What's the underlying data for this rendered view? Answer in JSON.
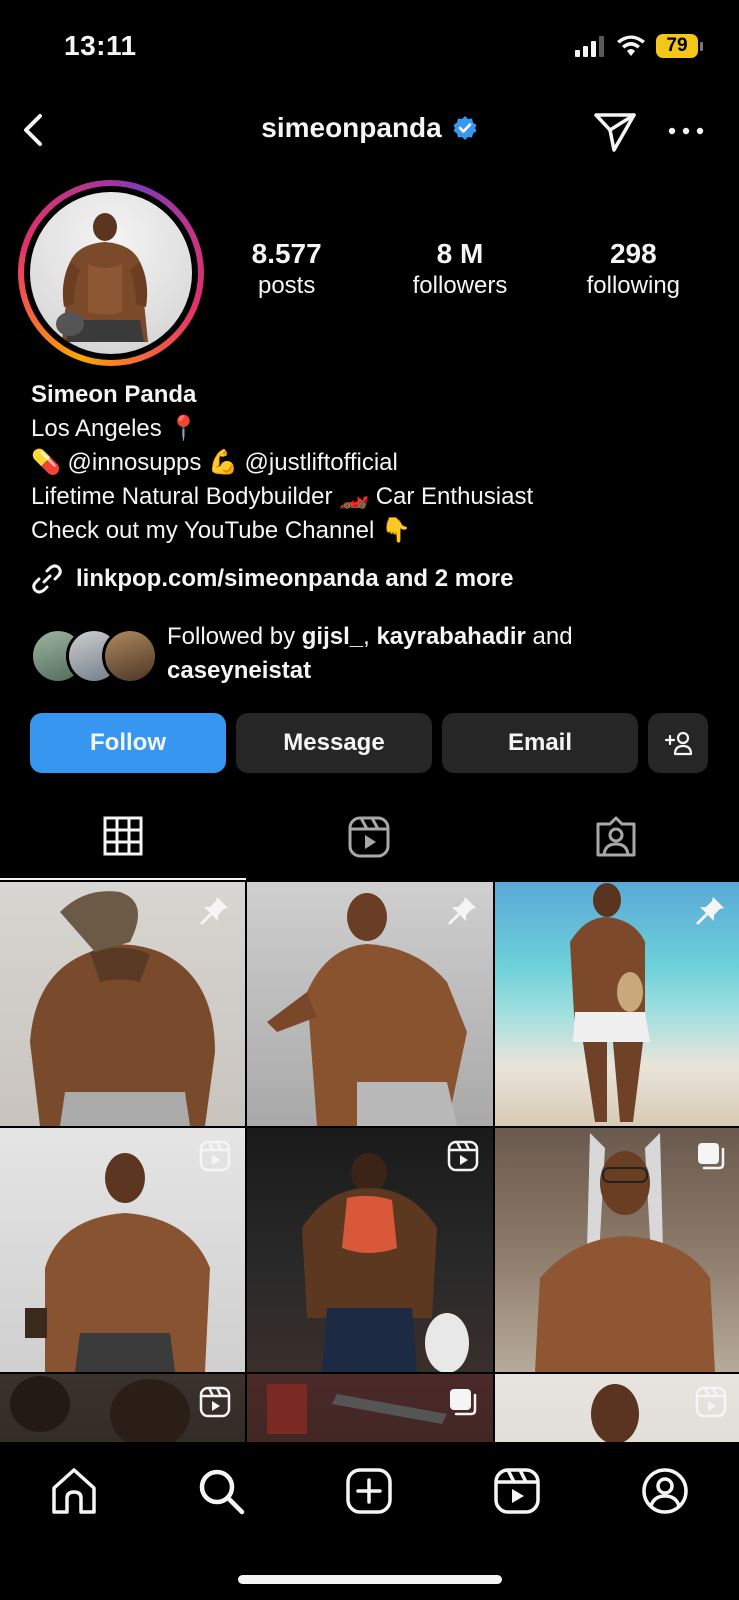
{
  "status": {
    "time": "13:11",
    "battery": "79"
  },
  "header": {
    "username": "simeonpanda",
    "verified": true
  },
  "stats": [
    {
      "value": "8.577",
      "label": "posts"
    },
    {
      "value": "8 M",
      "label": "followers"
    },
    {
      "value": "298",
      "label": "following"
    }
  ],
  "bio": {
    "name": "Simeon Panda",
    "lines": [
      "Los Angeles 📍",
      "💊 @innosupps 💪 @justliftofficial",
      "Lifetime Natural Bodybuilder 🏎️ Car Enthusiast",
      "Check out my YouTube Channel 👇"
    ],
    "link": "linkpop.com/simeonpanda and 2 more"
  },
  "followed_by": {
    "prefix": "Followed by ",
    "user1": "gijsl_",
    "sep": ", ",
    "user2": "kayrabahadir",
    "and": " and",
    "user3": "caseyneistat"
  },
  "actions": {
    "follow": "Follow",
    "message": "Message",
    "email": "Email"
  },
  "tabs": [
    "grid-icon",
    "reels-icon",
    "tagged-icon"
  ],
  "grid": [
    {
      "badge": "pin-icon"
    },
    {
      "badge": "pin-icon"
    },
    {
      "badge": "pin-icon"
    },
    {
      "badge": "reel-badge-icon"
    },
    {
      "badge": "reel-badge-icon"
    },
    {
      "badge": "carousel-icon"
    },
    {
      "badge": "reel-badge-icon"
    },
    {
      "badge": "carousel-icon"
    },
    {
      "badge": "reel-badge-icon"
    }
  ],
  "nav": [
    "home-icon",
    "search-icon",
    "create-icon",
    "reels-icon",
    "profile-icon"
  ]
}
